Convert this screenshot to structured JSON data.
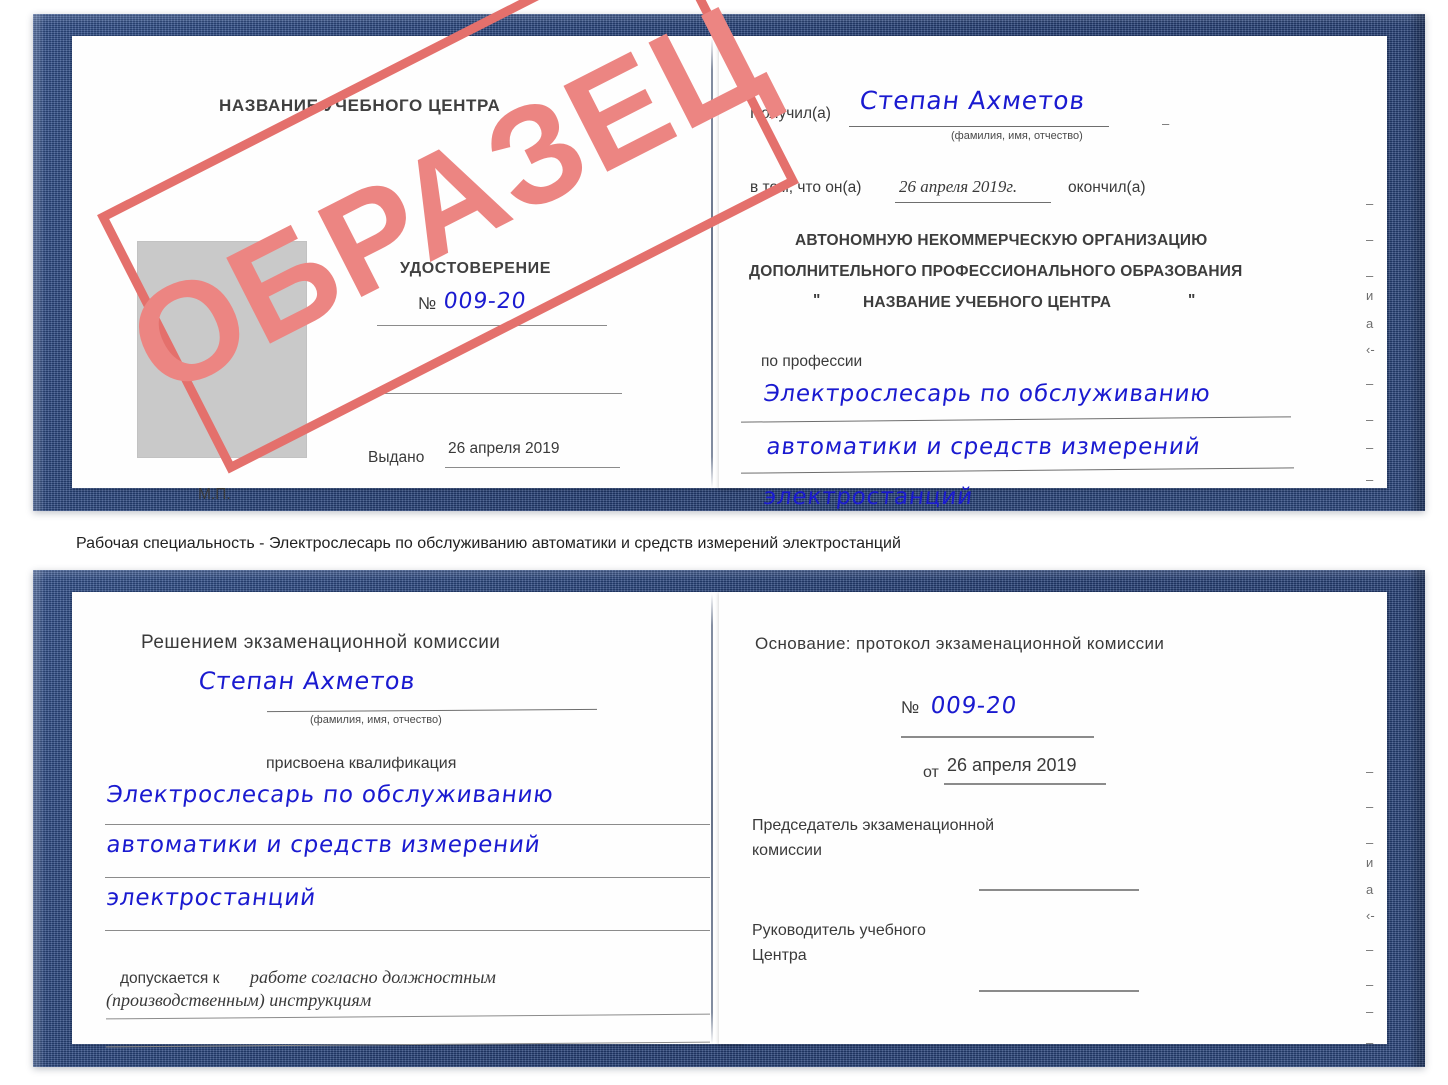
{
  "meta": {
    "colors": {
      "cover_blue": "#2c4a85",
      "stamp_red": "#e4706c",
      "handwriting_blue": "#1a1ad0",
      "photo_gray": "#c9c9c9",
      "rule_gray": "#8b8b8b"
    }
  },
  "stamp": {
    "label": "ОБРАЗЕЦ"
  },
  "certificate_top": {
    "left_page": {
      "center_name": "НАЗВАНИЕ УЧЕБНОГО ЦЕНТРА",
      "doc_type": "УДОСТОВЕРЕНИЕ",
      "number_symbol": "№",
      "number_value": "009-20",
      "issued_label": "Выдано",
      "issued_date": "26 апреля 2019",
      "seal_label": "М.П.",
      "photo_placeholder": ""
    },
    "right_page": {
      "received_label": "Получил(а)",
      "received_name": "Степан Ахметов",
      "name_hint": "(фамилия, имя, отчество)",
      "statement_prefix": "в том, что он(а)",
      "statement_date": "26 апреля 2019г.",
      "statement_suffix": "окончил(а)",
      "org_line_1": "АВТОНОМНУЮ НЕКОММЕРЧЕСКУЮ ОРГАНИЗАЦИЮ",
      "org_line_2": "ДОПОЛНИТЕЛЬНОГО ПРОФЕССИОНАЛЬНОГО ОБРАЗОВАНИЯ",
      "org_quote_open": "\"",
      "org_line_3": "НАЗВАНИЕ УЧЕБНОГО ЦЕНТРА",
      "org_quote_close": "\"",
      "profession_label": "по профессии",
      "profession_line_1": "Электрослесарь по обслуживанию",
      "profession_line_2": "автоматики и средств измерений",
      "profession_line_3": "электростанций",
      "edge_bleed": [
        "–",
        "–",
        "–",
        "и",
        "а",
        "‹-",
        "–",
        "–",
        "–",
        "–"
      ]
    }
  },
  "caption": {
    "text": "Рабочая специальность - Электрослесарь по обслуживанию автоматики и средств измерений электростанций"
  },
  "certificate_bottom": {
    "left_page": {
      "heading": "Решением экзаменационной комиссии",
      "person_name": "Степан Ахметов",
      "name_hint": "(фамилия, имя, отчество)",
      "qualification_label": "присвоена квалификация",
      "qualification_line_1": "Электрослесарь по обслуживанию",
      "qualification_line_2": "автоматики и средств измерений",
      "qualification_line_3": "электростанций",
      "admitted_label": "допускается к",
      "admitted_value_1": "работе согласно должностным",
      "admitted_value_2": "(производственным) инструкциям"
    },
    "right_page": {
      "basis_label": "Основание: протокол экзаменационной комиссии",
      "number_symbol": "№",
      "number_value": "009-20",
      "date_label": "от",
      "date_value": "26 апреля 2019",
      "chairman_line_1": "Председатель экзаменационной",
      "chairman_line_2": "комиссии",
      "head_line_1": "Руководитель учебного",
      "head_line_2": "Центра",
      "edge_bleed": [
        "–",
        "–",
        "–",
        "и",
        "а",
        "‹-",
        "–",
        "–",
        "–",
        "–"
      ]
    }
  }
}
